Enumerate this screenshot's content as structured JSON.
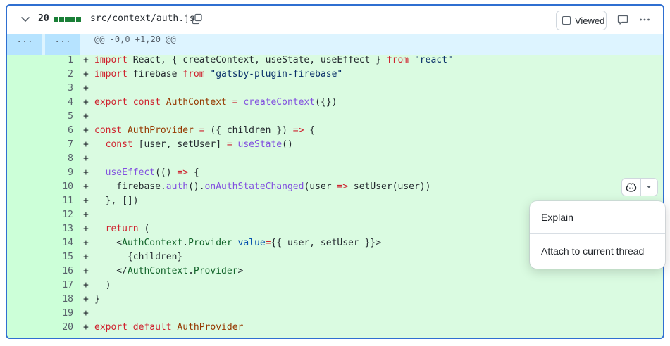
{
  "file": {
    "changes": "20",
    "path": "src/context/auth.js",
    "viewed_label": "Viewed"
  },
  "hunk": {
    "left": "...",
    "right": "...",
    "header": "@@ -0,0 +1,20 @@"
  },
  "lines": [
    {
      "n": "1",
      "code": "import React, { createContext, useState, useEffect } from \"react\""
    },
    {
      "n": "2",
      "code": "import firebase from \"gatsby-plugin-firebase\""
    },
    {
      "n": "3",
      "code": ""
    },
    {
      "n": "4",
      "code": "export const AuthContext = createContext({})"
    },
    {
      "n": "5",
      "code": ""
    },
    {
      "n": "6",
      "code": "const AuthProvider = ({ children }) => {"
    },
    {
      "n": "7",
      "code": "  const [user, setUser] = useState()"
    },
    {
      "n": "8",
      "code": ""
    },
    {
      "n": "9",
      "code": "  useEffect(() => {"
    },
    {
      "n": "10",
      "code": "    firebase.auth().onAuthStateChanged(user => setUser(user))"
    },
    {
      "n": "11",
      "code": "  }, [])"
    },
    {
      "n": "12",
      "code": ""
    },
    {
      "n": "13",
      "code": "  return ("
    },
    {
      "n": "14",
      "code": "    <AuthContext.Provider value={{ user, setUser }}>"
    },
    {
      "n": "15",
      "code": "      {children}"
    },
    {
      "n": "16",
      "code": "    </AuthContext.Provider>"
    },
    {
      "n": "17",
      "code": "  )"
    },
    {
      "n": "18",
      "code": "}"
    },
    {
      "n": "19",
      "code": ""
    },
    {
      "n": "20",
      "code": "export default AuthProvider"
    }
  ],
  "menu": {
    "explain": "Explain",
    "attach": "Attach to current thread"
  },
  "icons": {
    "collapse": "chevron-down-icon",
    "copy": "copy-icon",
    "comment": "comment-icon",
    "more": "kebab-horizontal-icon",
    "copilot": "copilot-icon",
    "dropdown": "triangle-down-icon"
  },
  "colors": {
    "added_bg": "#dafbe1",
    "added_gutter": "#ccffd8",
    "hunk_bg": "#ddf4ff",
    "frame_border": "#2f6fd1",
    "diffstat": "#1a7f37"
  }
}
